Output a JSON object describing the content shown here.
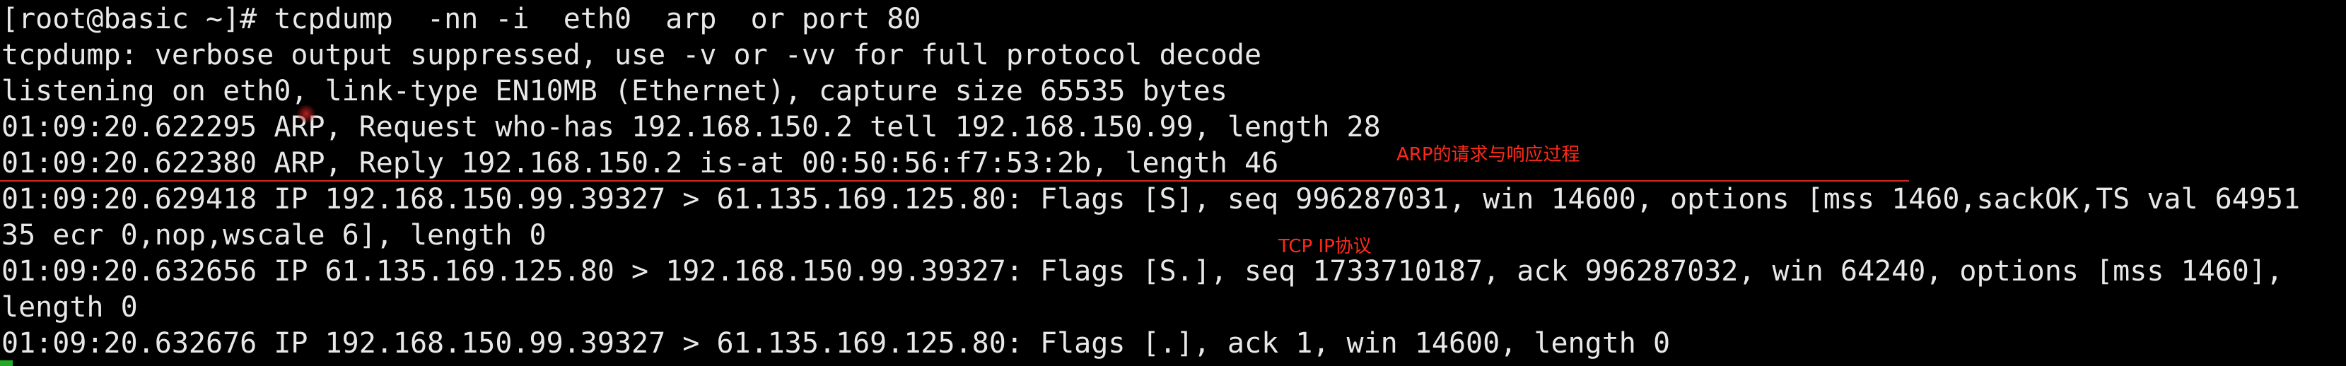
{
  "terminal": {
    "lines": [
      "[root@basic ~]# tcpdump  -nn -i  eth0  arp  or port 80",
      "tcpdump: verbose output suppressed, use -v or -vv for full protocol decode",
      "listening on eth0, link-type EN10MB (Ethernet), capture size 65535 bytes",
      "01:09:20.622295 ARP, Request who-has 192.168.150.2 tell 192.168.150.99, length 28",
      "01:09:20.622380 ARP, Reply 192.168.150.2 is-at 00:50:56:f7:53:2b, length 46",
      "01:09:20.629418 IP 192.168.150.99.39327 > 61.135.169.125.80: Flags [S], seq 996287031, win 14600, options [mss 1460,sackOK,TS val 64951",
      "35 ecr 0,nop,wscale 6], length 0",
      "01:09:20.632656 IP 61.135.169.125.80 > 192.168.150.99.39327: Flags [S.], seq 1733710187, ack 996287032, win 64240, options [mss 1460],",
      "length 0",
      "01:09:20.632676 IP 192.168.150.99.39327 > 61.135.169.125.80: Flags [.], ack 1, win 14600, length 0"
    ]
  },
  "annotations": {
    "arp_note": "ARP的请求与响应过程",
    "tcp_note": "TCP IP协议"
  },
  "colors": {
    "background": "#000000",
    "text": "#e8e8e8",
    "annotation": "#ff2a1a",
    "cursor": "#22aa22"
  }
}
